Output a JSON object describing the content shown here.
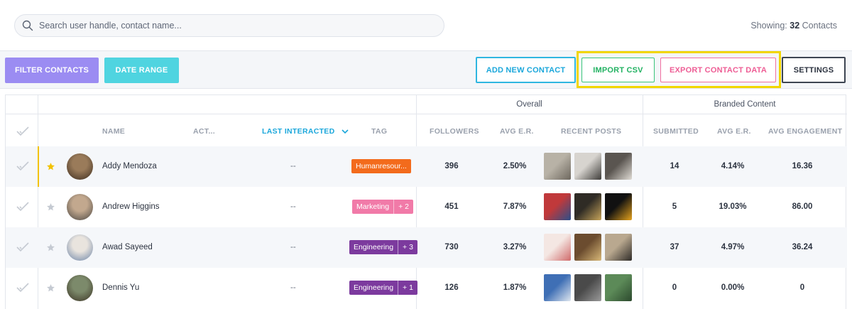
{
  "search": {
    "placeholder": "Search user handle, contact name..."
  },
  "showing": {
    "label": "Showing:",
    "count": "32",
    "suffix": "Contacts"
  },
  "toolbar": {
    "filter_label": "FILTER CONTACTS",
    "date_label": "DATE RANGE",
    "add_label": "ADD NEW CONTACT",
    "import_label": "IMPORT CSV",
    "export_label": "EXPORT CONTACT DATA",
    "settings_label": "SETTINGS"
  },
  "groups": {
    "overall": "Overall",
    "branded": "Branded Content"
  },
  "columns": {
    "name": "NAME",
    "act": "ACT...",
    "last": "LAST INTERACTED",
    "tag": "TAG",
    "followers": "FOLLOWERS",
    "avg_er": "AVG E.R.",
    "recent": "RECENT POSTS",
    "submitted": "SUBMITTED",
    "b_avg_er": "AVG E.R.",
    "avg_eng": "AVG ENGAGEMENT"
  },
  "colors": {
    "orange": "#f36b1c",
    "pink": "#f17aa8",
    "purple": "#7c3a9e",
    "star_on": "#f2c200",
    "star_off": "#c5cad2"
  },
  "rows": [
    {
      "name": "Addy Mendoza",
      "starred": true,
      "last": "--",
      "tag": "Humanresour...",
      "tag_color": "orange",
      "tag_more": "",
      "followers": "396",
      "avg_er": "2.50%",
      "submitted": "14",
      "b_avg_er": "4.14%",
      "avg_eng": "16.36"
    },
    {
      "name": "Andrew Higgins",
      "starred": false,
      "last": "--",
      "tag": "Marketing",
      "tag_color": "pink",
      "tag_more": "+ 2",
      "followers": "451",
      "avg_er": "7.87%",
      "submitted": "5",
      "b_avg_er": "19.03%",
      "avg_eng": "86.00"
    },
    {
      "name": "Awad Sayeed",
      "starred": false,
      "last": "--",
      "tag": "Engineering",
      "tag_color": "purple",
      "tag_more": "+ 3",
      "followers": "730",
      "avg_er": "3.27%",
      "submitted": "37",
      "b_avg_er": "4.97%",
      "avg_eng": "36.24"
    },
    {
      "name": "Dennis Yu",
      "starred": false,
      "last": "--",
      "tag": "Engineering",
      "tag_color": "purple",
      "tag_more": "+ 1",
      "followers": "126",
      "avg_er": "1.87%",
      "submitted": "0",
      "b_avg_er": "0.00%",
      "avg_eng": "0"
    }
  ]
}
